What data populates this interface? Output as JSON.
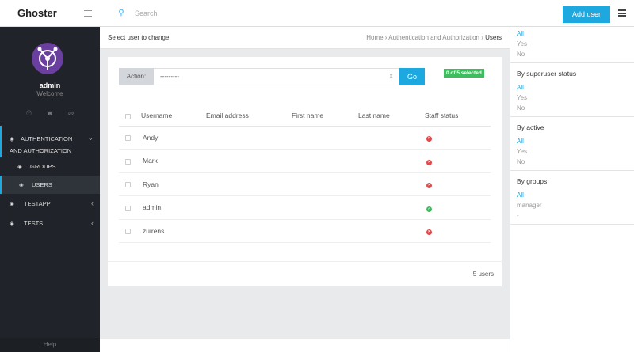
{
  "brand": {
    "name": "Ghoster"
  },
  "topbar": {
    "search_placeholder": "Search",
    "add_user_label": "Add user"
  },
  "user": {
    "name": "admin",
    "subtitle": "Welcome"
  },
  "sidebar": {
    "section_line1": "Authentication",
    "section_line2": "and Authorization",
    "items": [
      {
        "label": "Groups"
      },
      {
        "label": "Users",
        "active": true
      }
    ],
    "testapp": "Testapp",
    "tests": "Tests",
    "help": "Help"
  },
  "header": {
    "title": "Select user to change",
    "breadcrumb": {
      "home": "Home",
      "sep": " › ",
      "section": "Authentication and Authorization",
      "current": "Users"
    }
  },
  "actions": {
    "label": "Action:",
    "selected_value": "---------",
    "go_label": "Go",
    "selected_count": "0 of 5 selected"
  },
  "table": {
    "columns": [
      "Username",
      "Email address",
      "First name",
      "Last name",
      "Staff status"
    ],
    "rows": [
      {
        "username": "Andy",
        "email": "",
        "first": "",
        "last": "",
        "staff": false
      },
      {
        "username": "Mark",
        "email": "",
        "first": "",
        "last": "",
        "staff": false
      },
      {
        "username": "Ryan",
        "email": "",
        "first": "",
        "last": "",
        "staff": false
      },
      {
        "username": "admin",
        "email": "",
        "first": "",
        "last": "",
        "staff": true
      },
      {
        "username": "zuirens",
        "email": "",
        "first": "",
        "last": "",
        "staff": false
      }
    ]
  },
  "footer": {
    "count": "5 users"
  },
  "filters": [
    {
      "title": "",
      "options": [
        "All",
        "Yes",
        "No"
      ],
      "selected": 0
    },
    {
      "title": "By superuser status",
      "options": [
        "All",
        "Yes",
        "No"
      ],
      "selected": 0
    },
    {
      "title": "By active",
      "options": [
        "All",
        "Yes",
        "No"
      ],
      "selected": 0
    },
    {
      "title": "By groups",
      "options": [
        "All",
        "manager",
        "-"
      ],
      "selected": 0
    }
  ],
  "colors": {
    "accent": "#1ea8e0",
    "sidebar": "#202329",
    "success": "#3dbd5d",
    "danger": "#e34a4a"
  }
}
